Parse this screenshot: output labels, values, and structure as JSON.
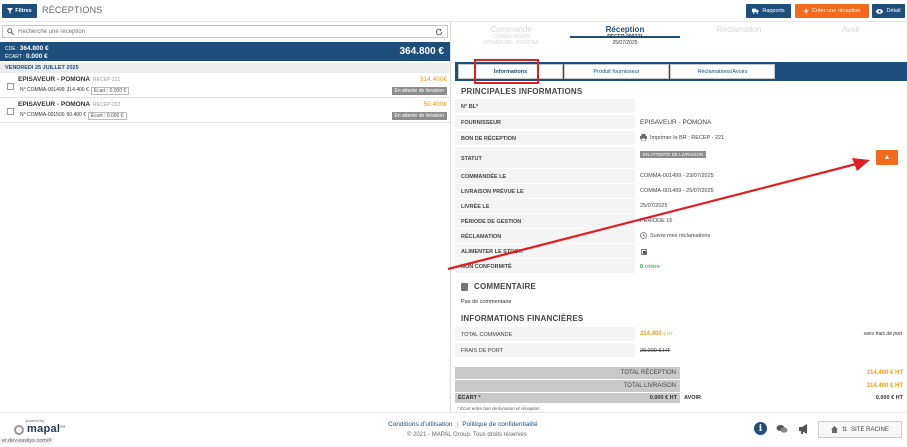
{
  "header": {
    "filter_label": "Filtres",
    "title": "RÉCEPTIONS",
    "btn_reports": "Rapports",
    "btn_create": "Créer une réception",
    "btn_detail": "Détail"
  },
  "search": {
    "placeholder": "Recherche une réception"
  },
  "summary": {
    "cde_label": "CDE :",
    "cde_value": "364.800 €",
    "ecart_label": "ÉCART :",
    "ecart_value": "0.000 €",
    "total": "364.800 €"
  },
  "list": {
    "date_header": "VENDREDI 25 JUILLET 2025",
    "items": [
      {
        "supplier": "EPISAVEUR - POMONA",
        "ref": "RECEP-221",
        "order": "N° COMMA-001499",
        "amount": "314.400 €",
        "ecart": "Écart : 0.000 €",
        "price": "314.400€",
        "status": "En attente de livraison"
      },
      {
        "supplier": "EPISAVEUR - POMONA",
        "ref": "RECEP-222",
        "order": "N° COMMA-001500",
        "amount": "50.400 €",
        "ecart": "Écart : 0.000 €",
        "price": "50.400€",
        "status": "En attente de livraison"
      }
    ]
  },
  "steps": [
    {
      "label": "Commande",
      "sub1": "COMMA-001499",
      "sub2": "EPISAVEUR - POMONA"
    },
    {
      "label": "Réception",
      "sub1": "RECEP-000221",
      "sub2": "25/07/2025"
    },
    {
      "label": "Réclamation",
      "sub1": "",
      "sub2": ""
    },
    {
      "label": "Avoir",
      "sub1": "",
      "sub2": ""
    }
  ],
  "tabs": [
    "Informations",
    "Produit fournisseur",
    "Réclamations/Avoirs"
  ],
  "info": {
    "section_title": "PRINCIPALES INFORMATIONS",
    "rows": [
      {
        "label": "N° BL*",
        "value": ""
      },
      {
        "label": "FOURNISSEUR",
        "value": "EPISAVEUR - POMONA"
      },
      {
        "label": "BON DE RÉCEPTION",
        "value": "Imprimer le BR : RECEP - 221"
      },
      {
        "label": "STATUT",
        "value": "EN ATTENTE DE LIVRAISON"
      },
      {
        "label": "COMMANDÉE LE",
        "value": "COMMA-001499 - 23/07/2025"
      },
      {
        "label": "LIVRAISON PRÉVUE LE",
        "value": "COMMA-001499 - 25/07/2025"
      },
      {
        "label": "LIVRÉE LE",
        "value": "25/07/2025"
      },
      {
        "label": "PÉRIODE DE GESTION",
        "value": "PÉRIODE 16"
      },
      {
        "label": "RÉCLAMATION",
        "value": "Suivre mes réclamations"
      },
      {
        "label": "ALIMENTER LE STOCK",
        "value": ""
      },
      {
        "label": "NON CONFORMITÉ",
        "value_num": "0",
        "value_text": "critère"
      }
    ]
  },
  "comment": {
    "title": "COMMENTAIRE",
    "text": "Pas de commentaire"
  },
  "finance": {
    "title": "INFORMATIONS FINANCIÈRES",
    "total_cmd_label": "TOTAL COMMANDE",
    "total_cmd_value": "214.400",
    "total_cmd_unit": "€ HT",
    "shipping_note": "sans frais de port",
    "port_label": "FRAIS DE PORT",
    "port_value": "20.000 € HT"
  },
  "totals": {
    "reception_label": "TOTAL RÉCEPTION",
    "reception_value": "314.400 € HT",
    "livraison_label": "TOTAL LIVRAISON",
    "livraison_value": "314.400 € HT",
    "ecart_label": "ÉCART *",
    "ecart_value": "0.000 € HT",
    "avoir_label": "AVOIR",
    "avoir_value": "0.000 € HT",
    "footnote": "* Écart entre bon de livraison et réception"
  },
  "footer": {
    "conditions": "Conditions d'utilisation",
    "separator": "|",
    "privacy": "Politique de confidentialité",
    "copyright": "© 2021 - MAPAL Group. Tous droits réservés",
    "powered": "powered by",
    "brand": "mapal",
    "brand_sup": "os",
    "url": "er.dev.easilys.com/#",
    "site_root": "SITE RACINE"
  },
  "colors": {
    "primary": "#1e4f7c",
    "accent": "#f26b1d",
    "amount": "#f39c12",
    "annotation": "#e02020"
  }
}
